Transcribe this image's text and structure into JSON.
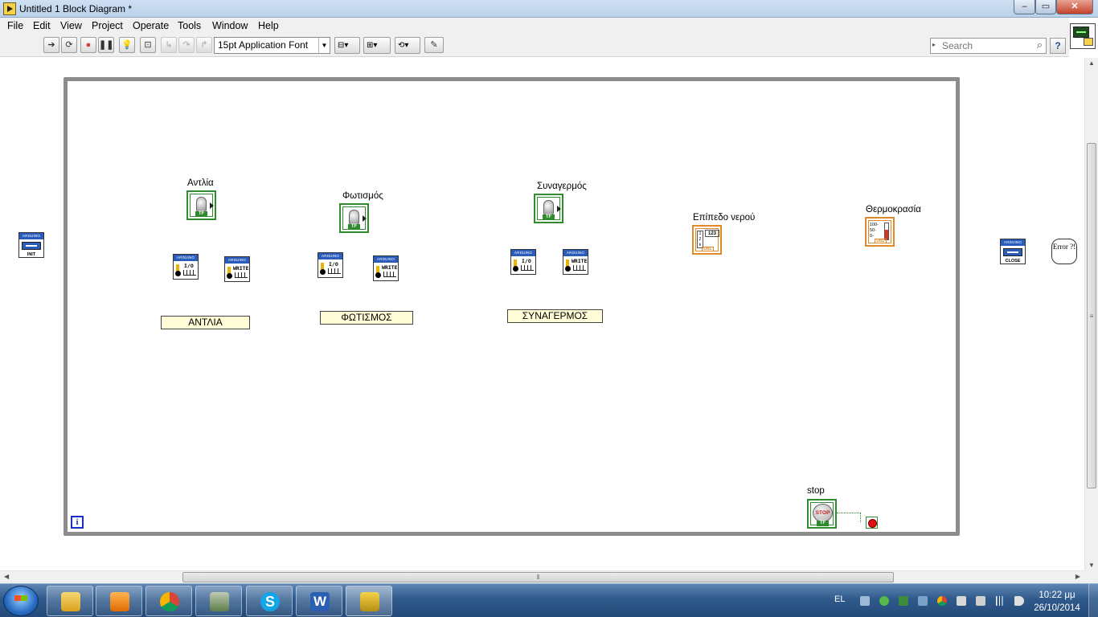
{
  "window": {
    "title": "Untitled 1 Block Diagram *",
    "buttons": [
      "–",
      "▭",
      "✕"
    ]
  },
  "menu": [
    "File",
    "Edit",
    "View",
    "Project",
    "Operate",
    "Tools",
    "Window",
    "Help"
  ],
  "toolbar": {
    "font": "15pt Application Font",
    "search_placeholder": "Search",
    "help": "?"
  },
  "diagram": {
    "controls": [
      {
        "label": "Αντλία",
        "constant": "ΑΝΤΛΙΑ"
      },
      {
        "label": "Φωτισμός",
        "constant": "ΦΩΤΙΣΜΟΣ"
      },
      {
        "label": "Συναγερμός",
        "constant": "ΣΥΝΑΓΕΡΜΟΣ"
      }
    ],
    "indicators": [
      {
        "label": "Επίπεδο νερού",
        "type": "numeric",
        "display": "123",
        "repr": "DBL"
      },
      {
        "label": "Θερμοκρασία",
        "type": "thermometer",
        "scale": [
          "100-",
          "50-",
          "0-"
        ],
        "repr": "DBL"
      }
    ],
    "stop": {
      "label": "stop",
      "text": "STOP"
    },
    "subvis": {
      "banner": "ARDUINO",
      "io": "I/O",
      "write": "WRITE",
      "init": "INIT",
      "close": "CLOSE",
      "tf": "TF"
    },
    "iteration": "i",
    "error": "Error ?!"
  },
  "taskbar": {
    "language": "EL",
    "time": "10:22 μμ",
    "date": "26/10/2014",
    "apps": [
      "explorer",
      "media-player",
      "chrome",
      "network-tool",
      "skype",
      "word",
      "labview"
    ]
  }
}
